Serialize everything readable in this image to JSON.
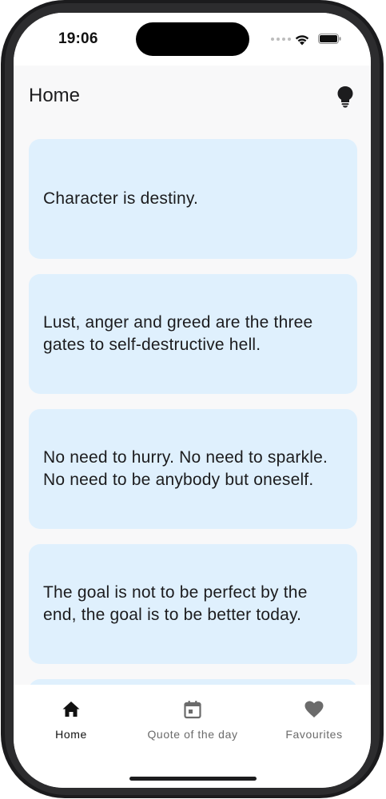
{
  "status_bar": {
    "time": "19:06"
  },
  "app_bar": {
    "title": "Home",
    "action_icon": "lightbulb-icon"
  },
  "quotes": [
    {
      "text": "Character is destiny."
    },
    {
      "text": "Lust, anger and greed are the three gates to self-destructive hell."
    },
    {
      "text": "No need to hurry. No need to sparkle. No need to be anybody but oneself."
    },
    {
      "text": "The goal is not to be perfect by the end, the goal is to be better today."
    },
    {
      "text": ""
    }
  ],
  "bottom_nav": {
    "items": [
      {
        "label": "Home",
        "icon": "home-icon",
        "active": true
      },
      {
        "label": "Quote of the day",
        "icon": "calendar-icon",
        "active": false
      },
      {
        "label": "Favourites",
        "icon": "heart-icon",
        "active": false
      }
    ]
  },
  "colors": {
    "card_background": "#dff0fd",
    "screen_background": "#f8f8f9",
    "active_nav": "#111111",
    "inactive_nav": "#6b6b6b"
  }
}
